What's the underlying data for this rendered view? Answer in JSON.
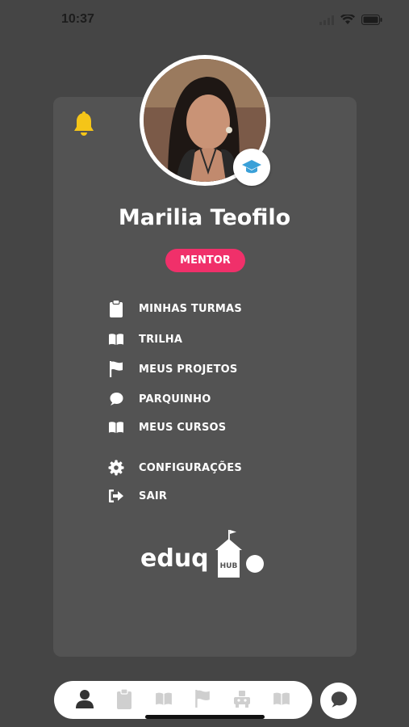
{
  "status_bar": {
    "time": "10:37"
  },
  "profile": {
    "name": "Marilia Teofilo",
    "role": "MENTOR"
  },
  "menu": {
    "items": [
      {
        "label": "MINHAS TURMAS",
        "icon": "clipboard-icon"
      },
      {
        "label": "TRILHA",
        "icon": "book-icon"
      },
      {
        "label": "MEUS PROJETOS",
        "icon": "flag-icon"
      },
      {
        "label": "PARQUINHO",
        "icon": "chat-bubble-icon"
      },
      {
        "label": "MEUS CURSOS",
        "icon": "book-icon"
      },
      {
        "label": "CONFIGURAÇÕES",
        "icon": "gear-icon"
      },
      {
        "label": "SAIR",
        "icon": "sign-out-icon"
      }
    ]
  },
  "logo": {
    "text": "eduq",
    "badge": "HUB"
  },
  "tabbar": {
    "tabs": [
      "profile-icon",
      "clipboard-icon",
      "book-icon",
      "flag-icon",
      "robot-icon",
      "book-icon"
    ],
    "active": "profile-icon"
  },
  "colors": {
    "background": "#454545",
    "card": "#535353",
    "accent_pink": "#f0306a",
    "bell_yellow": "#f5c518",
    "cap_blue": "#3aa0d8"
  }
}
